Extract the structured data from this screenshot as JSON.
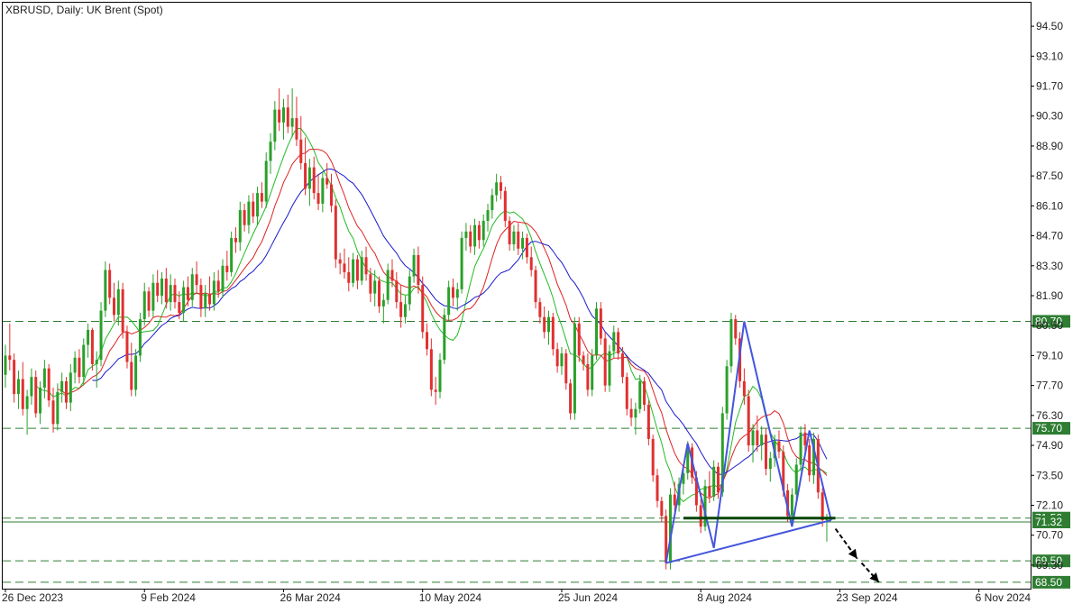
{
  "chart_data": {
    "type": "candlestick",
    "title": "XBRUSD, Daily:  UK Brent (Spot)",
    "y_ticks": [
      "94.50",
      "93.10",
      "91.70",
      "90.30",
      "88.90",
      "87.50",
      "86.10",
      "84.70",
      "83.30",
      "81.90",
      "80.50",
      "79.10",
      "77.70",
      "76.30",
      "74.90",
      "73.50",
      "72.10",
      "70.70",
      "69.30"
    ],
    "ylim": [
      68.2,
      95.6
    ],
    "x_ticks": [
      "26 Dec 2023",
      "9 Feb 2024",
      "26 Mar 2024",
      "10 May 2024",
      "25 Jun 2024",
      "8 Aug 2024",
      "23 Sep 2024",
      "6 Nov 2024"
    ],
    "levels": [
      {
        "value": 80.7,
        "label": "80.70",
        "style": "dashed",
        "color": "#2e7d32"
      },
      {
        "value": 75.7,
        "label": "75.70",
        "style": "dashed",
        "color": "#2e7d32"
      },
      {
        "value": 71.5,
        "label": "71.50",
        "style": "dashed",
        "color": "#2e7d32"
      },
      {
        "value": 71.32,
        "label": "71.32",
        "style": "solid",
        "color": "#2e7d32"
      },
      {
        "value": 69.5,
        "label": "69.50",
        "style": "dashed",
        "color": "#2e7d32"
      },
      {
        "value": 68.5,
        "label": "68.50",
        "style": "dashed",
        "color": "#2e7d32"
      }
    ],
    "candles_ohlc": [
      [
        78.2,
        79.6,
        77.6,
        79.1
      ],
      [
        79.1,
        80.6,
        78.4,
        78.9
      ],
      [
        78.9,
        79.2,
        76.9,
        77.3
      ],
      [
        77.3,
        78.4,
        76.6,
        78.0
      ],
      [
        78.0,
        78.8,
        76.3,
        76.6
      ],
      [
        76.6,
        77.5,
        75.4,
        77.2
      ],
      [
        77.2,
        78.5,
        76.8,
        78.1
      ],
      [
        78.1,
        78.4,
        76.2,
        76.4
      ],
      [
        76.4,
        77.9,
        75.9,
        77.6
      ],
      [
        77.6,
        78.9,
        77.1,
        78.5
      ],
      [
        78.5,
        78.7,
        76.7,
        77.0
      ],
      [
        77.0,
        77.6,
        75.5,
        75.9
      ],
      [
        75.9,
        77.8,
        75.6,
        77.4
      ],
      [
        77.4,
        78.3,
        76.9,
        77.9
      ],
      [
        77.9,
        78.1,
        76.6,
        76.9
      ],
      [
        76.9,
        78.7,
        76.5,
        78.3
      ],
      [
        78.3,
        79.3,
        77.8,
        79.0
      ],
      [
        79.0,
        79.4,
        77.8,
        78.1
      ],
      [
        78.1,
        79.9,
        77.7,
        79.6
      ],
      [
        79.6,
        80.6,
        79.0,
        80.3
      ],
      [
        80.3,
        80.4,
        78.4,
        78.7
      ],
      [
        78.7,
        79.3,
        77.6,
        78.9
      ],
      [
        78.9,
        81.6,
        78.6,
        81.2
      ],
      [
        81.2,
        83.5,
        80.9,
        83.1
      ],
      [
        83.1,
        83.4,
        81.5,
        81.8
      ],
      [
        81.8,
        82.5,
        80.7,
        81.0
      ],
      [
        81.0,
        82.6,
        80.5,
        82.2
      ],
      [
        82.2,
        82.5,
        79.9,
        80.2
      ],
      [
        80.2,
        80.5,
        78.5,
        78.8
      ],
      [
        78.8,
        79.7,
        77.2,
        77.5
      ],
      [
        77.5,
        79.4,
        77.2,
        79.1
      ],
      [
        79.1,
        81.1,
        78.8,
        80.8
      ],
      [
        80.8,
        82.5,
        80.5,
        82.1
      ],
      [
        82.1,
        82.3,
        80.9,
        81.2
      ],
      [
        81.2,
        82.9,
        80.9,
        82.5
      ],
      [
        82.5,
        83.1,
        81.6,
        81.9
      ],
      [
        81.9,
        83.0,
        81.5,
        82.7
      ],
      [
        82.7,
        83.2,
        81.3,
        81.6
      ],
      [
        81.6,
        82.9,
        81.2,
        82.4
      ],
      [
        82.4,
        82.7,
        81.3,
        81.6
      ],
      [
        81.6,
        82.1,
        80.8,
        81.1
      ],
      [
        81.1,
        82.6,
        80.7,
        82.3
      ],
      [
        82.3,
        82.8,
        81.4,
        81.7
      ],
      [
        81.7,
        83.2,
        81.4,
        82.9
      ],
      [
        82.9,
        83.5,
        82.0,
        82.4
      ],
      [
        82.4,
        82.7,
        80.9,
        81.3
      ],
      [
        81.3,
        82.4,
        80.9,
        82.0
      ],
      [
        82.0,
        82.8,
        81.2,
        81.5
      ],
      [
        81.5,
        83.0,
        81.2,
        82.6
      ],
      [
        82.6,
        83.1,
        81.8,
        82.1
      ],
      [
        82.1,
        83.6,
        81.8,
        83.3
      ],
      [
        83.3,
        84.0,
        82.6,
        83.0
      ],
      [
        83.0,
        84.9,
        82.8,
        84.6
      ],
      [
        84.6,
        85.1,
        83.9,
        84.4
      ],
      [
        84.4,
        86.3,
        84.0,
        85.9
      ],
      [
        85.9,
        86.2,
        84.9,
        85.2
      ],
      [
        85.2,
        86.6,
        84.8,
        86.3
      ],
      [
        86.3,
        86.7,
        85.3,
        85.6
      ],
      [
        85.6,
        87.0,
        85.2,
        86.7
      ],
      [
        86.7,
        87.2,
        86.0,
        86.3
      ],
      [
        86.3,
        88.6,
        86.0,
        88.2
      ],
      [
        88.2,
        89.5,
        87.6,
        89.1
      ],
      [
        89.1,
        91.0,
        88.7,
        90.6
      ],
      [
        90.6,
        91.6,
        89.6,
        90.0
      ],
      [
        90.0,
        91.1,
        89.2,
        90.7
      ],
      [
        90.7,
        91.3,
        89.5,
        89.8
      ],
      [
        89.8,
        91.6,
        89.3,
        90.2
      ],
      [
        90.2,
        91.2,
        88.9,
        89.2
      ],
      [
        89.2,
        90.3,
        87.8,
        88.1
      ],
      [
        88.1,
        89.3,
        86.6,
        86.9
      ],
      [
        86.9,
        88.3,
        86.1,
        87.9
      ],
      [
        87.9,
        88.4,
        86.4,
        86.7
      ],
      [
        86.7,
        87.6,
        85.9,
        86.2
      ],
      [
        86.2,
        87.7,
        85.8,
        87.4
      ],
      [
        87.4,
        88.1,
        86.9,
        87.1
      ],
      [
        87.1,
        87.6,
        85.8,
        86.1
      ],
      [
        86.1,
        86.4,
        83.2,
        83.6
      ],
      [
        83.6,
        83.9,
        82.9,
        83.4
      ],
      [
        83.4,
        84.1,
        82.7,
        83.0
      ],
      [
        83.0,
        83.7,
        82.1,
        82.5
      ],
      [
        82.5,
        83.9,
        82.3,
        83.6
      ],
      [
        83.6,
        83.8,
        82.2,
        82.6
      ],
      [
        82.6,
        84.0,
        82.4,
        83.7
      ],
      [
        83.7,
        84.2,
        82.6,
        82.9
      ],
      [
        82.9,
        83.2,
        81.6,
        82.0
      ],
      [
        82.0,
        83.1,
        81.4,
        82.6
      ],
      [
        82.6,
        82.8,
        81.1,
        81.4
      ],
      [
        81.4,
        82.0,
        80.6,
        81.7
      ],
      [
        81.7,
        83.4,
        81.5,
        83.1
      ],
      [
        83.1,
        83.6,
        82.3,
        82.6
      ],
      [
        82.6,
        83.0,
        81.3,
        81.6
      ],
      [
        81.6,
        82.4,
        80.4,
        80.9
      ],
      [
        80.9,
        81.9,
        80.6,
        81.5
      ],
      [
        81.5,
        83.1,
        81.2,
        82.8
      ],
      [
        82.8,
        84.1,
        82.5,
        83.8
      ],
      [
        83.8,
        84.2,
        82.0,
        82.4
      ],
      [
        82.4,
        82.8,
        79.9,
        80.2
      ],
      [
        80.2,
        80.6,
        79.1,
        79.4
      ],
      [
        79.4,
        79.9,
        77.2,
        77.5
      ],
      [
        77.5,
        78.1,
        76.8,
        77.4
      ],
      [
        77.4,
        79.2,
        77.1,
        78.9
      ],
      [
        78.9,
        81.3,
        78.7,
        81.0
      ],
      [
        81.0,
        82.6,
        80.7,
        82.3
      ],
      [
        82.3,
        82.7,
        81.4,
        81.8
      ],
      [
        81.8,
        82.5,
        81.2,
        82.2
      ],
      [
        82.2,
        84.9,
        82.0,
        84.6
      ],
      [
        84.6,
        85.3,
        84.0,
        84.9
      ],
      [
        84.9,
        85.2,
        83.9,
        84.2
      ],
      [
        84.2,
        85.5,
        83.8,
        85.2
      ],
      [
        85.2,
        85.4,
        84.1,
        84.5
      ],
      [
        84.5,
        85.7,
        84.2,
        85.4
      ],
      [
        85.4,
        86.2,
        84.9,
        85.9
      ],
      [
        85.9,
        86.9,
        85.5,
        86.6
      ],
      [
        86.6,
        87.6,
        86.3,
        87.2
      ],
      [
        87.2,
        87.5,
        86.4,
        86.8
      ],
      [
        86.8,
        87.0,
        85.1,
        85.4
      ],
      [
        85.4,
        85.6,
        84.0,
        84.3
      ],
      [
        84.3,
        85.2,
        84.0,
        84.9
      ],
      [
        84.9,
        85.3,
        83.8,
        84.1
      ],
      [
        84.1,
        84.9,
        83.6,
        84.6
      ],
      [
        84.6,
        84.8,
        83.4,
        83.7
      ],
      [
        83.7,
        84.2,
        82.8,
        83.1
      ],
      [
        83.1,
        83.3,
        81.3,
        81.6
      ],
      [
        81.6,
        81.8,
        80.6,
        80.9
      ],
      [
        80.9,
        81.4,
        79.9,
        80.2
      ],
      [
        80.2,
        81.2,
        79.6,
        80.9
      ],
      [
        80.9,
        81.1,
        79.1,
        79.4
      ],
      [
        79.4,
        79.7,
        78.3,
        78.6
      ],
      [
        78.6,
        79.5,
        78.2,
        79.2
      ],
      [
        79.2,
        79.4,
        77.5,
        77.8
      ],
      [
        77.8,
        78.0,
        76.1,
        76.4
      ],
      [
        76.4,
        80.9,
        76.1,
        80.6
      ],
      [
        80.6,
        80.9,
        78.8,
        79.1
      ],
      [
        79.1,
        79.3,
        78.4,
        78.7
      ],
      [
        78.7,
        79.2,
        77.2,
        77.5
      ],
      [
        77.5,
        79.4,
        77.2,
        79.1
      ],
      [
        79.1,
        81.6,
        78.9,
        81.3
      ],
      [
        81.3,
        81.6,
        79.6,
        79.9
      ],
      [
        79.9,
        80.2,
        77.4,
        77.7
      ],
      [
        77.7,
        79.6,
        77.4,
        79.3
      ],
      [
        79.3,
        80.5,
        79.0,
        80.2
      ],
      [
        80.2,
        80.4,
        78.9,
        79.2
      ],
      [
        79.2,
        79.5,
        77.8,
        78.1
      ],
      [
        78.1,
        78.3,
        76.3,
        76.6
      ],
      [
        76.6,
        77.1,
        75.8,
        76.2
      ],
      [
        76.2,
        76.9,
        75.4,
        76.6
      ],
      [
        76.6,
        78.2,
        76.4,
        77.9
      ],
      [
        77.9,
        78.1,
        76.5,
        76.8
      ],
      [
        76.8,
        77.0,
        74.9,
        75.2
      ],
      [
        75.2,
        75.4,
        73.2,
        73.5
      ],
      [
        73.5,
        73.8,
        72.0,
        72.3
      ],
      [
        72.3,
        72.5,
        71.3,
        71.6
      ],
      [
        71.6,
        71.9,
        69.1,
        69.4
      ],
      [
        69.4,
        72.9,
        69.1,
        72.6
      ],
      [
        72.6,
        73.2,
        71.8,
        72.1
      ],
      [
        72.1,
        73.4,
        71.8,
        73.1
      ],
      [
        73.1,
        73.9,
        72.6,
        73.6
      ],
      [
        73.6,
        75.1,
        73.3,
        74.8
      ],
      [
        74.8,
        75.0,
        73.1,
        73.4
      ],
      [
        73.4,
        73.7,
        71.8,
        72.1
      ],
      [
        72.1,
        72.4,
        70.8,
        71.1
      ],
      [
        71.1,
        73.3,
        70.9,
        73.0
      ],
      [
        73.0,
        73.7,
        72.2,
        72.5
      ],
      [
        72.5,
        74.2,
        72.3,
        73.9
      ],
      [
        73.9,
        74.1,
        72.4,
        72.7
      ],
      [
        72.7,
        76.7,
        72.5,
        76.4
      ],
      [
        76.4,
        78.9,
        76.1,
        78.6
      ],
      [
        78.6,
        81.1,
        78.3,
        80.8
      ],
      [
        80.8,
        81.0,
        79.6,
        79.9
      ],
      [
        79.9,
        80.2,
        77.6,
        77.9
      ],
      [
        77.9,
        78.5,
        76.8,
        77.2
      ],
      [
        77.2,
        77.5,
        74.6,
        74.9
      ],
      [
        74.9,
        75.9,
        74.1,
        75.6
      ],
      [
        75.6,
        76.3,
        74.6,
        74.9
      ],
      [
        74.9,
        75.8,
        74.2,
        75.4
      ],
      [
        75.4,
        75.7,
        73.5,
        73.8
      ],
      [
        73.8,
        74.6,
        73.2,
        74.3
      ],
      [
        74.3,
        75.4,
        73.9,
        75.1
      ],
      [
        75.1,
        75.6,
        74.3,
        74.6
      ],
      [
        74.6,
        74.9,
        72.5,
        72.8
      ],
      [
        72.8,
        73.1,
        71.3,
        71.6
      ],
      [
        71.6,
        72.9,
        71.2,
        72.6
      ],
      [
        72.6,
        74.3,
        72.3,
        74.0
      ],
      [
        74.0,
        75.8,
        73.7,
        75.5
      ],
      [
        75.5,
        75.9,
        74.6,
        74.9
      ],
      [
        74.9,
        75.2,
        73.2,
        73.5
      ],
      [
        73.5,
        75.5,
        73.1,
        75.2
      ],
      [
        75.2,
        75.4,
        72.4,
        72.7
      ],
      [
        72.7,
        72.9,
        71.1,
        71.4
      ],
      [
        71.4,
        71.7,
        70.4,
        71.5
      ]
    ],
    "moving_averages": [
      {
        "period": 8,
        "color": "#22bb22"
      },
      {
        "period": 13,
        "color": "#dd2222"
      },
      {
        "period": 21,
        "color": "#1a1acc"
      }
    ],
    "pattern_points": [
      [
        152,
        69.4
      ],
      [
        157,
        75.0
      ],
      [
        163,
        70.1
      ],
      [
        170,
        80.7
      ],
      [
        181,
        71.1
      ],
      [
        185,
        75.6
      ],
      [
        190,
        71.4
      ]
    ],
    "pattern_lines": [
      {
        "from": [
          152,
          69.4
        ],
        "to": [
          190,
          71.4
        ],
        "color": "#4455dd"
      },
      {
        "from": [
          156,
          71.5
        ],
        "to": [
          191,
          71.5
        ],
        "color": "#004400"
      }
    ],
    "arrows": [
      {
        "from": [
          191,
          71.0
        ],
        "to": [
          196,
          69.6
        ]
      },
      {
        "from": [
          197,
          69.4
        ],
        "to": [
          201,
          68.5
        ]
      }
    ]
  }
}
